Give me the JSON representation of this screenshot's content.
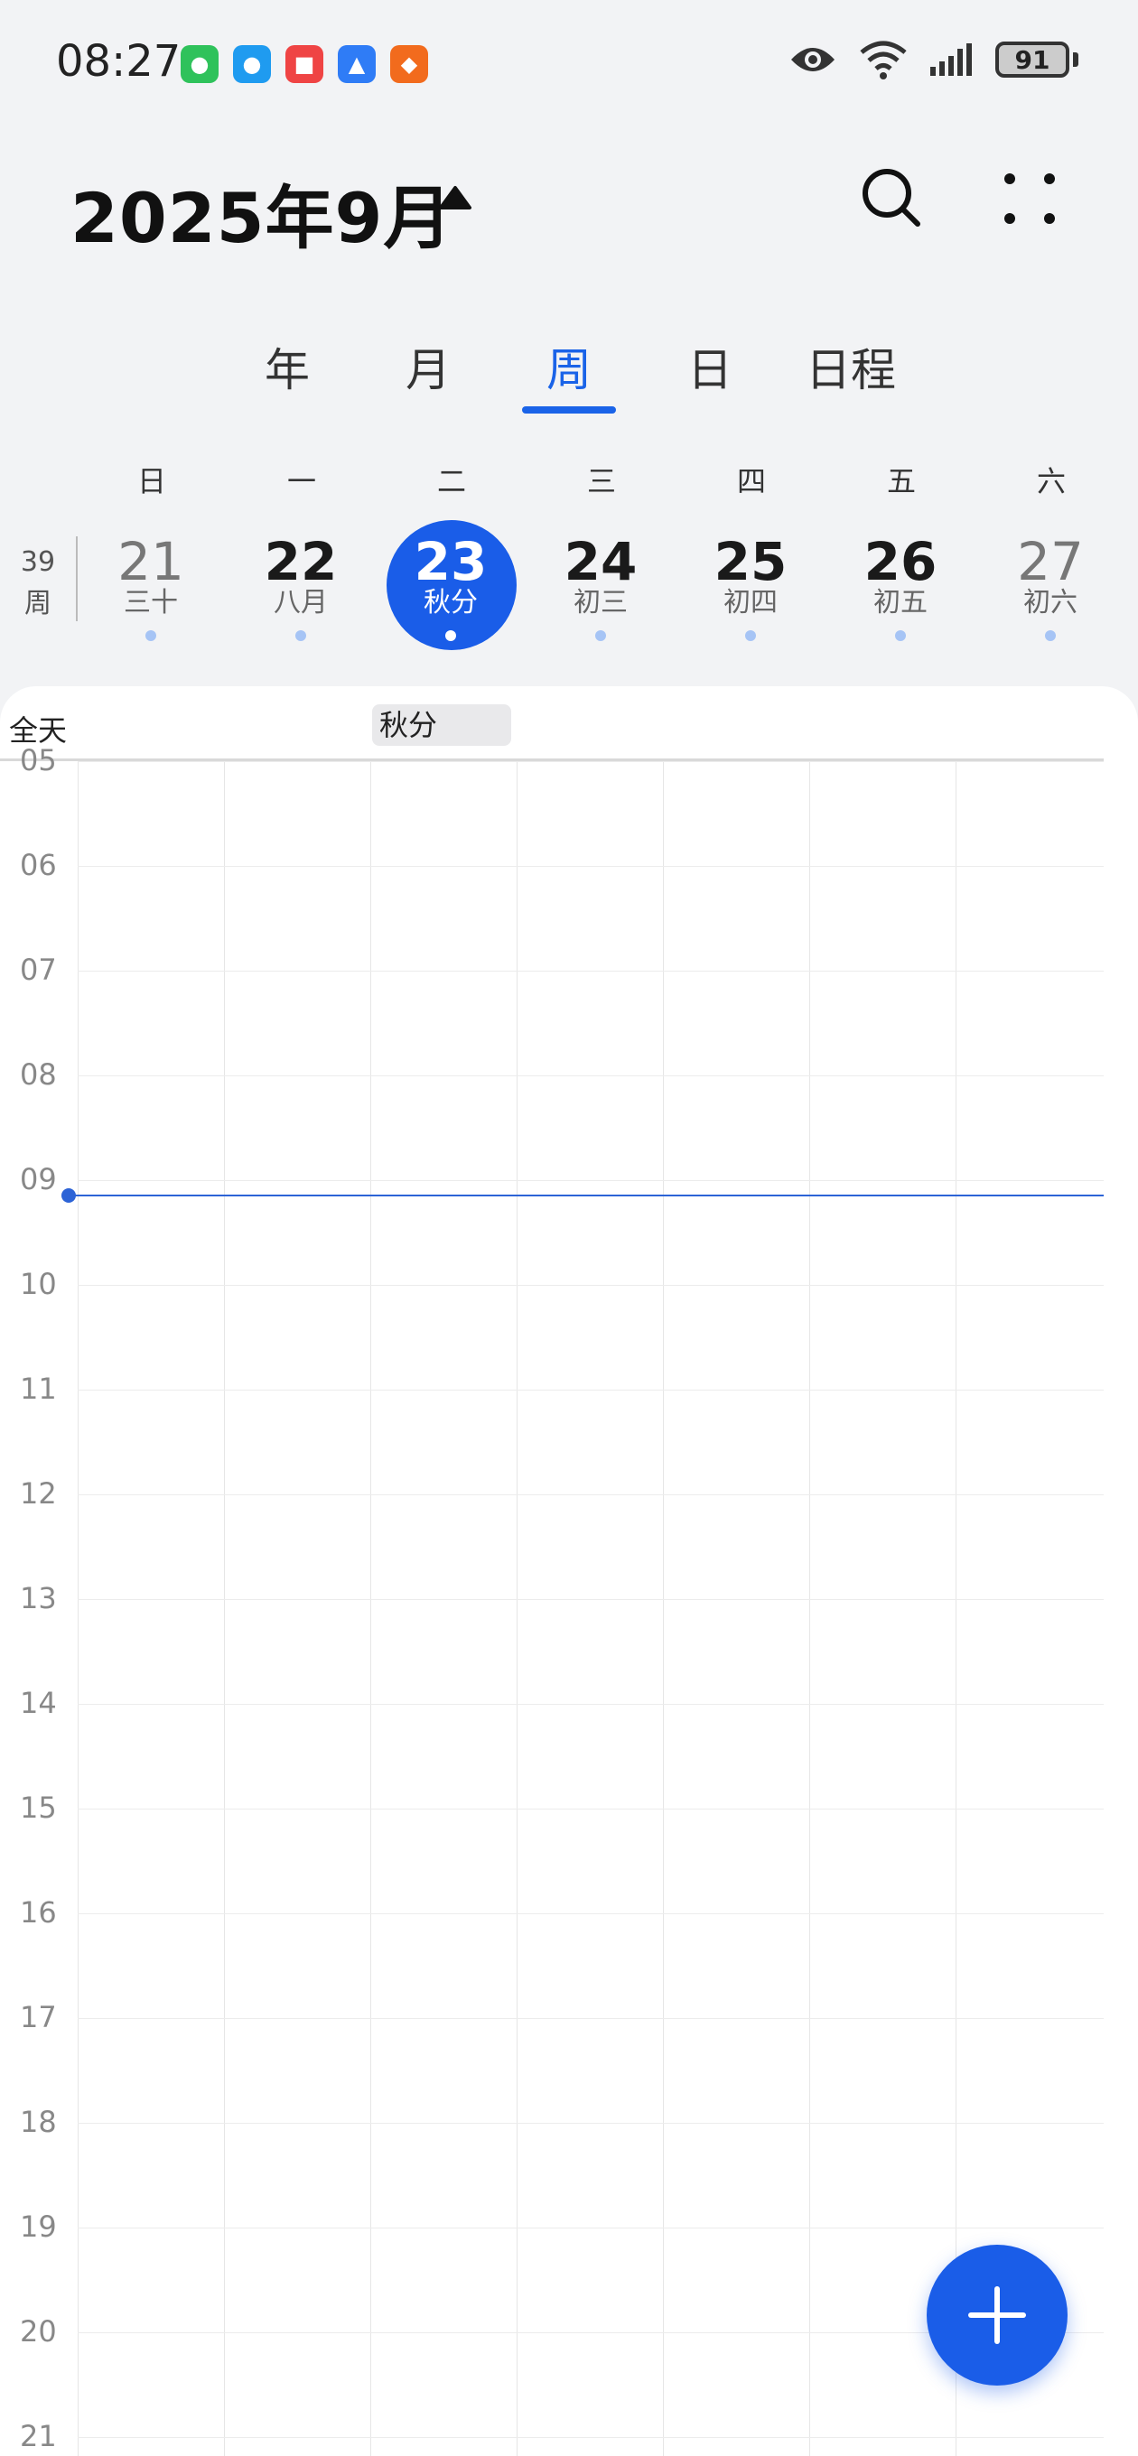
{
  "status_bar": {
    "time": "08:27",
    "battery": "91",
    "apps": [
      {
        "name": "wechat-icon",
        "color": "#2fc25b"
      },
      {
        "name": "message-icon",
        "color": "#1f9bf0"
      },
      {
        "name": "red-app-icon",
        "color": "#ef4444"
      },
      {
        "name": "blue-app-icon",
        "color": "#2f7cf6"
      },
      {
        "name": "orange-app-icon",
        "color": "#f26b1d"
      }
    ]
  },
  "header": {
    "title": "2025年9月"
  },
  "tabs": [
    {
      "label": "年",
      "active": false
    },
    {
      "label": "月",
      "active": false
    },
    {
      "label": "周",
      "active": true
    },
    {
      "label": "日",
      "active": false
    },
    {
      "label": "日程",
      "active": false
    }
  ],
  "week": {
    "number": "39",
    "suffix": "周",
    "weekdays": [
      "日",
      "一",
      "二",
      "三",
      "四",
      "五",
      "六"
    ],
    "days": [
      {
        "date": "21",
        "lunar": "三十"
      },
      {
        "date": "22",
        "lunar": "八月"
      },
      {
        "date": "23",
        "lunar": "秋分"
      },
      {
        "date": "24",
        "lunar": "初三"
      },
      {
        "date": "25",
        "lunar": "初四"
      },
      {
        "date": "26",
        "lunar": "初五"
      },
      {
        "date": "27",
        "lunar": "初六"
      }
    ]
  },
  "all_day": {
    "label": "全天",
    "event": "秋分"
  },
  "hours": [
    "05",
    "06",
    "07",
    "08",
    "09",
    "10",
    "11",
    "12",
    "13",
    "14",
    "15",
    "16",
    "17",
    "18",
    "19",
    "20",
    "21"
  ],
  "colors": {
    "accent": "#1a5de8",
    "now_line": "#2c63d6"
  }
}
